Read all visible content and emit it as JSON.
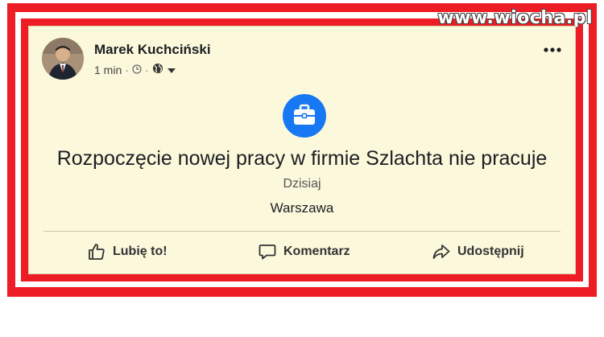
{
  "watermark": "www.wiocha.pl",
  "post": {
    "author": "Marek Kuchciński",
    "time": "1 min",
    "separator": "·",
    "headline": "Rozpoczęcie nowej pracy w firmie Szlachta nie pracuje",
    "date": "Dzisiaj",
    "place": "Warszawa"
  },
  "actions": {
    "like": "Lubię to!",
    "comment": "Komentarz",
    "share": "Udostępnij"
  },
  "icons": {
    "clock": "clock-icon",
    "globe": "globe-icon",
    "dropdown": "caret-down-icon",
    "more": "more-options-icon",
    "briefcase": "briefcase-icon",
    "like": "thumbs-up-icon",
    "comment": "comment-icon",
    "share": "share-arrow-icon"
  },
  "colors": {
    "frame": "#ee1c24",
    "card": "#fbf8dc",
    "accent": "#1877f2"
  }
}
